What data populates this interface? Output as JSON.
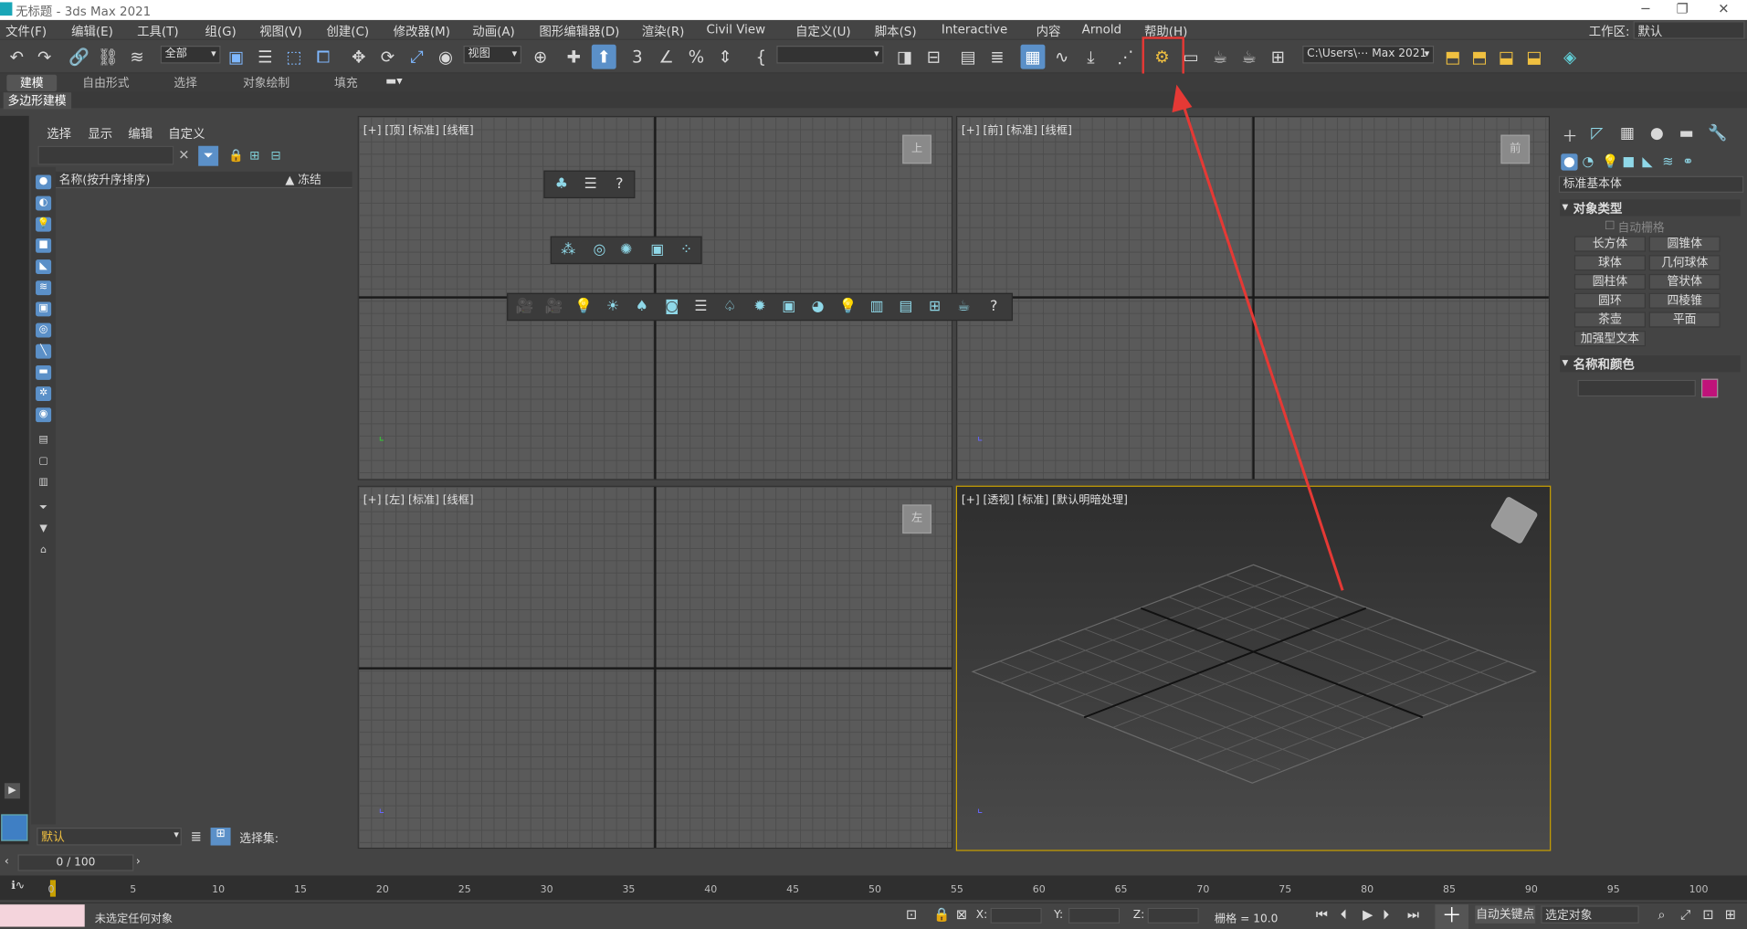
{
  "window": {
    "title": "无标题 - 3ds Max 2021",
    "minimize": "─",
    "maximize": "❐",
    "close": "✕"
  },
  "menu": [
    "文件(F)",
    "编辑(E)",
    "工具(T)",
    "组(G)",
    "视图(V)",
    "创建(C)",
    "修改器(M)",
    "动画(A)",
    "图形编辑器(D)",
    "渲染(R)",
    "Civil View",
    "自定义(U)",
    "脚本(S)",
    "Interactive",
    "内容",
    "Arnold",
    "帮助(H)"
  ],
  "workspace": {
    "label": "工作区:",
    "value": "默认"
  },
  "toolbar": {
    "filter": "全部",
    "refcoord": "视图",
    "named_selection": "",
    "path": "C:\\Users\\⋯ Max 2021"
  },
  "ribbon": {
    "tabs": [
      "建模",
      "自由形式",
      "选择",
      "对象绘制",
      "填充"
    ],
    "sub": "多边形建模"
  },
  "explorer": {
    "menu": [
      "选择",
      "显示",
      "编辑",
      "自定义"
    ],
    "col_name": "名称(按升序排序)",
    "col_freeze": "▲ 冻结",
    "layer": "默认",
    "selection_set": "选择集:"
  },
  "viewports": {
    "top": {
      "label": "[+] [顶] [标准] [线框]",
      "cube": "上"
    },
    "front": {
      "label": "[+] [前] [标准] [线框]",
      "cube": "前"
    },
    "left": {
      "label": "[+] [左] [标准] [线框]",
      "cube": "左"
    },
    "persp": {
      "label": "[+] [透视] [标准] [默认明暗处理]"
    }
  },
  "command_panel": {
    "dropdown": "标准基本体",
    "object_type": "对象类型",
    "auto_grid": "自动栅格",
    "buttons": [
      "长方体",
      "圆锥体",
      "球体",
      "几何球体",
      "圆柱体",
      "管状体",
      "圆环",
      "四棱锥",
      "茶壶",
      "平面",
      "加强型文本"
    ],
    "name_color": "名称和颜色",
    "object_color": "#c0127a"
  },
  "timeline": {
    "frame": "0 / 100",
    "ticks": [
      "0",
      "5",
      "10",
      "15",
      "20",
      "25",
      "30",
      "35",
      "40",
      "45",
      "50",
      "55",
      "60",
      "65",
      "70",
      "75",
      "80",
      "85",
      "90",
      "95",
      "100"
    ]
  },
  "status": {
    "message": "未选定任何对象",
    "x": "X:",
    "y": "Y:",
    "z": "Z:",
    "grid": "栅格 = 10.0",
    "auto_key": "自动关键点",
    "set_key": "选定对象"
  },
  "colors": {
    "highlight": "#e53935",
    "accent": "#5b90c8",
    "active_viewport": "#c8a000"
  }
}
